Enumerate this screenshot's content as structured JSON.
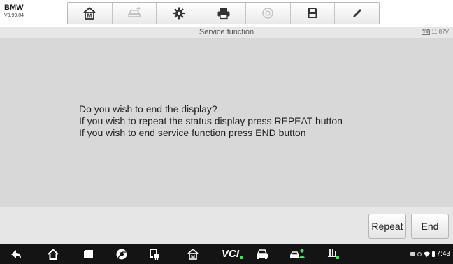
{
  "header": {
    "brand": "BMW",
    "version": "V0.99.04",
    "toolbar": [
      {
        "icon": "home-m-icon"
      },
      {
        "icon": "vehicle-swap-icon"
      },
      {
        "icon": "gear-icon"
      },
      {
        "icon": "printer-icon"
      },
      {
        "icon": "help-icon"
      },
      {
        "icon": "save-icon"
      },
      {
        "icon": "pen-icon"
      }
    ]
  },
  "titlebar": {
    "title": "Service function",
    "battery": "11.87V"
  },
  "messages": [
    "Do you wish to end the display?",
    "If you wish to repeat the status display press REPEAT button",
    "If you wish to end service function press END button"
  ],
  "actions": {
    "repeat_label": "Repeat",
    "end_label": "End"
  },
  "navbar": {
    "vcl_label": "VCI",
    "clock": "7:43"
  }
}
